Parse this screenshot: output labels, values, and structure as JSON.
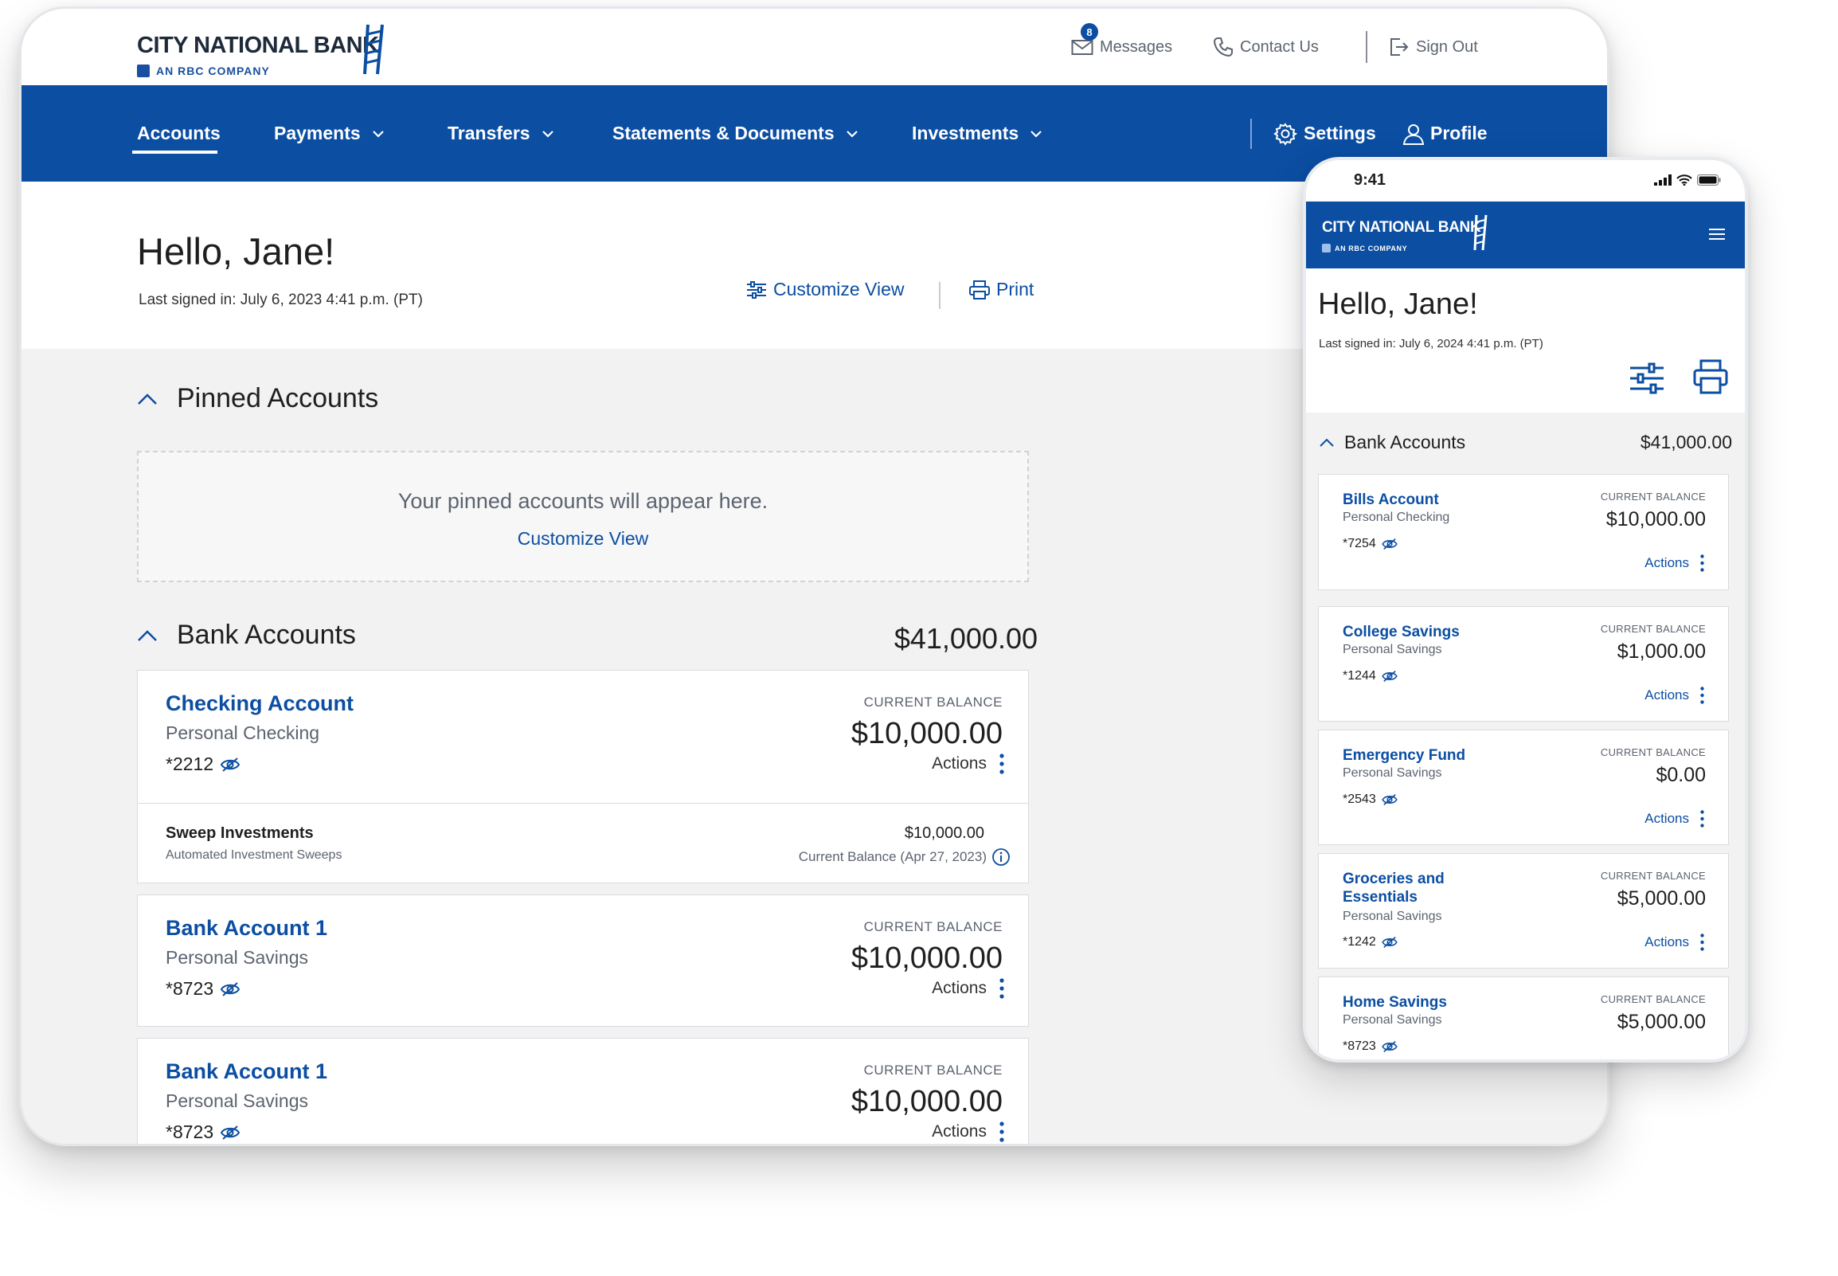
{
  "desktop": {
    "brand": {
      "name": "City National Bank",
      "tagline": "AN RBC COMPANY"
    },
    "utility": {
      "messages_label": "Messages",
      "messages_count": "8",
      "contact_label": "Contact Us",
      "signout_label": "Sign Out"
    },
    "nav": {
      "accounts": "Accounts",
      "payments": "Payments",
      "transfers": "Transfers",
      "statements": "Statements & Documents",
      "investments": "Investments",
      "settings": "Settings",
      "profile": "Profile"
    },
    "greeting": "Hello, Jane!",
    "last_signed": "Last signed in: July 6, 2023 4:41 p.m. (PT)",
    "customize_view": "Customize View",
    "print": "Print",
    "pinned": {
      "title": "Pinned Accounts",
      "empty_message": "Your pinned accounts will appear here.",
      "link": "Customize View"
    },
    "bank": {
      "title": "Bank Accounts",
      "total": "$41,000.00",
      "balance_label": "CURRENT BALANCE",
      "actions_label": "Actions",
      "accounts": [
        {
          "name": "Checking Account",
          "type": "Personal Checking",
          "number": "*2212",
          "balance": "$10,000.00"
        },
        {
          "name": "Bank Account 1",
          "type": "Personal Savings",
          "number": "*8723",
          "balance": "$10,000.00"
        },
        {
          "name": "Bank Account 1",
          "type": "Personal Savings",
          "number": "*8723",
          "balance": "$10,000.00"
        }
      ],
      "sweep": {
        "name": "Sweep Investments",
        "subtitle": "Automated Investment Sweeps",
        "value": "$10,000.00",
        "balance_note": "Current Balance (Apr 27, 2023)"
      }
    }
  },
  "mobile": {
    "time": "9:41",
    "brand": {
      "name": "City National Bank",
      "tagline": "AN RBC COMPANY"
    },
    "greeting": "Hello, Jane!",
    "last_signed": "Last signed in: July 6, 2024 4:41 p.m. (PT)",
    "section_title": "Bank Accounts",
    "section_total": "$41,000.00",
    "balance_label": "CURRENT BALANCE",
    "actions_label": "Actions",
    "accounts": [
      {
        "name": "Bills Account",
        "type": "Personal Checking",
        "number": "*7254",
        "balance": "$10,000.00"
      },
      {
        "name": "College Savings",
        "type": "Personal Savings",
        "number": "*1244",
        "balance": "$1,000.00"
      },
      {
        "name": "Emergency Fund",
        "type": "Personal Savings",
        "number": "*2543",
        "balance": "$0.00"
      },
      {
        "name": "Groceries and Essentials",
        "type": "Personal Savings",
        "number": "*1242",
        "balance": "$5,000.00"
      },
      {
        "name": "Home Savings",
        "type": "Personal Savings",
        "number": "*8723",
        "balance": "$5,000.00"
      }
    ]
  },
  "colors": {
    "brand_blue": "#0b4ea2",
    "page_gray": "#f2f2f2",
    "text_dark": "#1f1f1f",
    "text_muted": "#5c6470"
  }
}
